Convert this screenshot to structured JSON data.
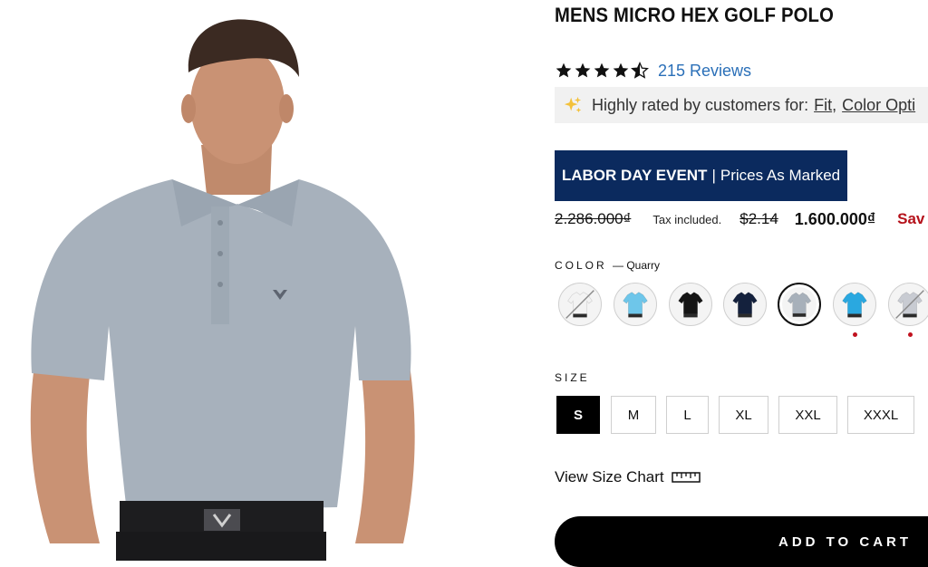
{
  "product": {
    "title": "MENS MICRO HEX GOLF POLO",
    "rating": 4.5,
    "reviews_label": "215 Reviews"
  },
  "highlight": {
    "prefix": "Highly rated by customers for:",
    "tags": [
      "Fit",
      "Color Opti"
    ]
  },
  "event": {
    "name": "LABOR DAY EVENT",
    "separator": "|",
    "note": "Prices As Marked"
  },
  "price": {
    "original": "2.286.000₫",
    "tax_note": "Tax included.",
    "usd_original": "$2.14",
    "sale": "1.600.000₫",
    "save_label": "Sav"
  },
  "color": {
    "label": "COLOR",
    "selected_value": "— Quarry",
    "swatches": [
      {
        "color": "#f3f3f3",
        "unavailable": true,
        "selected": false
      },
      {
        "color": "#6ec6ea",
        "unavailable": false,
        "selected": false
      },
      {
        "color": "#151515",
        "unavailable": false,
        "selected": false
      },
      {
        "color": "#14213d",
        "unavailable": false,
        "selected": false
      },
      {
        "color": "#a7b0ba",
        "unavailable": false,
        "selected": true
      },
      {
        "color": "#2aa8e0",
        "unavailable": false,
        "selected": false
      },
      {
        "color": "#c8cbd2",
        "unavailable": true,
        "selected": false
      }
    ]
  },
  "size": {
    "label": "SIZE",
    "options": [
      {
        "label": "S",
        "selected": true
      },
      {
        "label": "M",
        "selected": false
      },
      {
        "label": "L",
        "selected": false
      },
      {
        "label": "XL",
        "selected": false
      },
      {
        "label": "XXL",
        "selected": false
      },
      {
        "label": "XXXL",
        "selected": false
      }
    ]
  },
  "size_chart": {
    "label": "View Size Chart",
    "icon": "ruler-icon"
  },
  "cart": {
    "button_label": "ADD TO CART"
  },
  "colors": {
    "event_banner": "#0b2a5e",
    "link": "#2a6fb8",
    "sale_red": "#b5121b",
    "swatch_dot": "#c1121f",
    "highlight_bg": "#f1f1f1"
  }
}
